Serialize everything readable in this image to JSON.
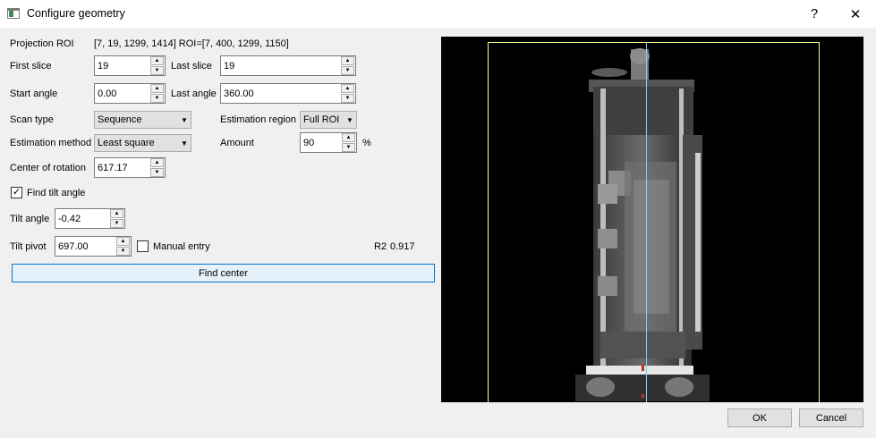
{
  "window": {
    "title": "Configure geometry",
    "help_label": "?",
    "close_label": "✕"
  },
  "roi": {
    "label": "Projection ROI",
    "value": "[7, 19, 1299, 1414] ROI=[7, 400, 1299, 1150]"
  },
  "first_slice": {
    "label": "First slice",
    "value": "19"
  },
  "last_slice": {
    "label": "Last slice",
    "value": "19"
  },
  "start_angle": {
    "label": "Start angle",
    "value": "0.00"
  },
  "last_angle": {
    "label": "Last angle",
    "value": "360.00"
  },
  "scan_type": {
    "label": "Scan type",
    "value": "Sequence"
  },
  "estimation_region": {
    "label": "Estimation region",
    "value": "Full ROI"
  },
  "estimation_method": {
    "label": "Estimation method",
    "value": "Least square"
  },
  "amount": {
    "label": "Amount",
    "value": "90",
    "unit": "%"
  },
  "center_of_rotation": {
    "label": "Center of rotation",
    "value": "617.17"
  },
  "find_tilt": {
    "label": "Find tilt angle",
    "checked": true,
    "mark": "✓"
  },
  "tilt_angle": {
    "label": "Tilt angle",
    "value": "-0.42"
  },
  "tilt_pivot": {
    "label": "Tilt pivot",
    "value": "697.00"
  },
  "manual_entry": {
    "label": "Manual entry",
    "checked": false
  },
  "r2": {
    "label": "R2",
    "value": "0.917"
  },
  "find_center_label": "Find center",
  "spin_up": "▲",
  "spin_down": "▼",
  "combo_arrow": "▼",
  "ok_label": "OK",
  "cancel_label": "Cancel",
  "colors": {
    "roi_box": "#ffff80",
    "axis_line": "#7fd4e8",
    "focus_border": "#0078d7"
  }
}
